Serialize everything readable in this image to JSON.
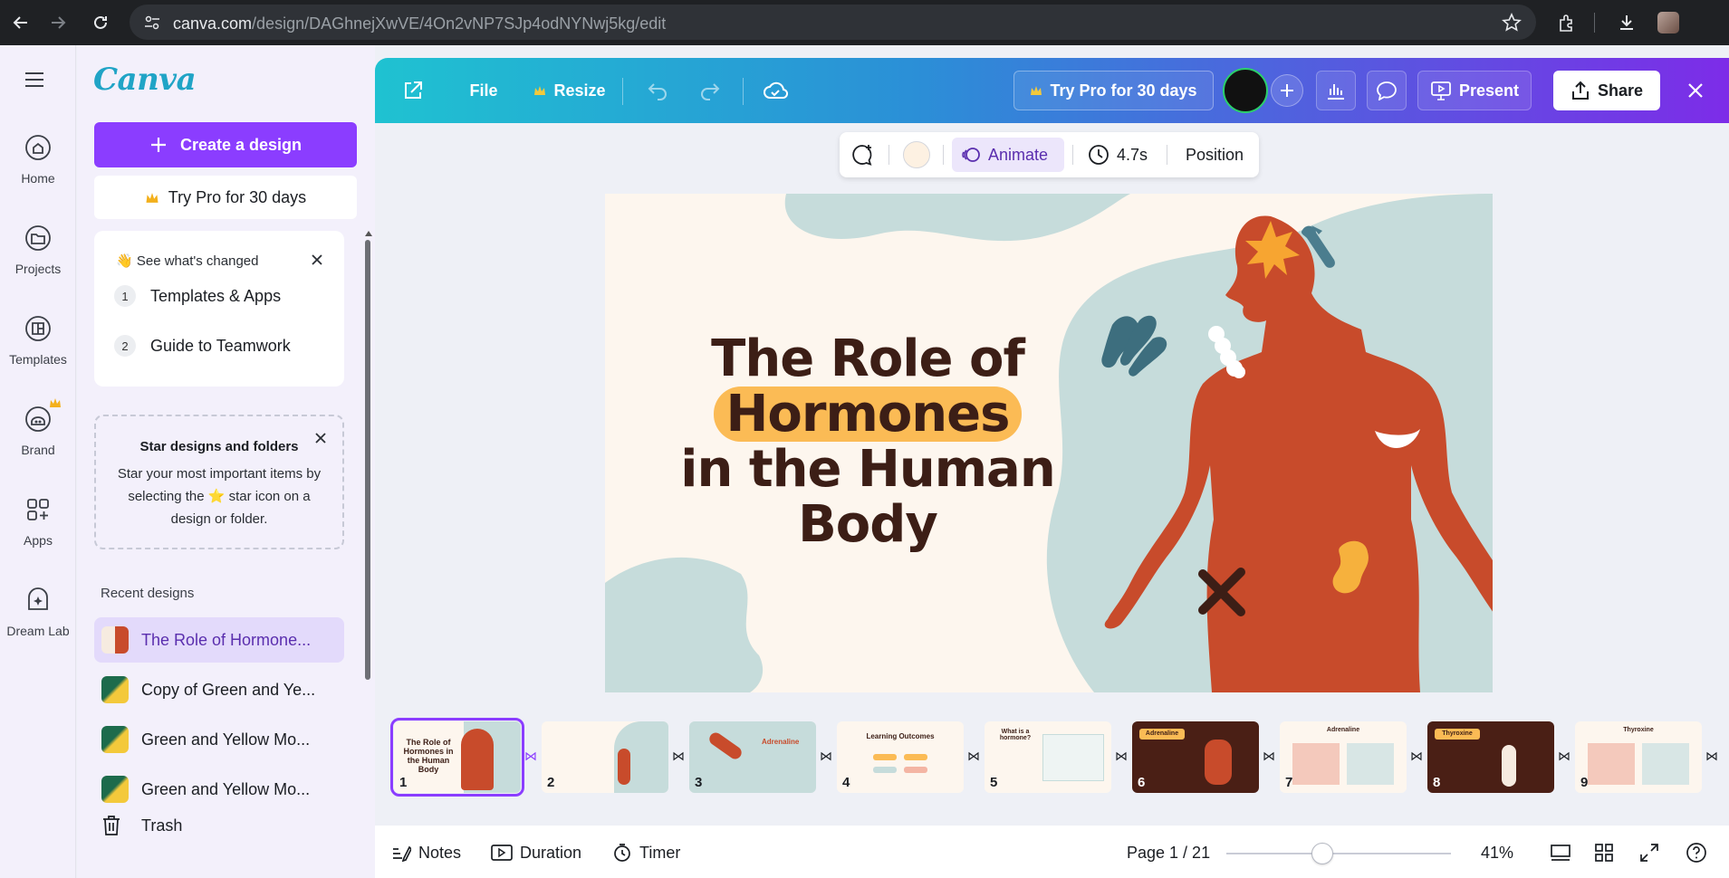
{
  "browser": {
    "url_host": "canva.com",
    "url_path": "/design/DAGhnejXwVE/4On2vNP7SJp4odNYNwj5kg/edit"
  },
  "rail": {
    "items": [
      {
        "label": "Home"
      },
      {
        "label": "Projects"
      },
      {
        "label": "Templates"
      },
      {
        "label": "Brand"
      },
      {
        "label": "Apps"
      },
      {
        "label": "Dream Lab"
      }
    ]
  },
  "panel": {
    "logo": "Canva",
    "create_label": "Create a design",
    "try_pro_label": "Try Pro for 30 days",
    "changes": {
      "title": "See what's changed",
      "items": [
        {
          "num": "1",
          "label": "Templates & Apps"
        },
        {
          "num": "2",
          "label": "Guide to Teamwork"
        }
      ]
    },
    "star_card": {
      "title": "Star designs and folders",
      "body": "Star your most important items by selecting the ⭐ star icon on a design or folder."
    },
    "recent_heading": "Recent designs",
    "recent": [
      {
        "label": "The Role of Hormone..."
      },
      {
        "label": "Copy of Green and Ye..."
      },
      {
        "label": "Green and Yellow Mo..."
      },
      {
        "label": "Green and Yellow Mo..."
      }
    ],
    "trash_label": "Trash"
  },
  "topbar": {
    "file_label": "File",
    "resize_label": "Resize",
    "try_pro_label": "Try Pro for 30 days",
    "present_label": "Present",
    "share_label": "Share"
  },
  "floatbar": {
    "animate_label": "Animate",
    "duration_value": "4.7s",
    "position_label": "Position"
  },
  "slide": {
    "title_line1": "The Role of",
    "title_highlight": "Hormones",
    "title_line3": "in the Human",
    "title_line4": "Body"
  },
  "filmstrip": {
    "slides": [
      {
        "num": "1",
        "title": "The Role of Hormones in the Human Body"
      },
      {
        "num": "2",
        "title": ""
      },
      {
        "num": "3",
        "title": "Adrenaline"
      },
      {
        "num": "4",
        "title": "Learning Outcomes"
      },
      {
        "num": "5",
        "title": "What is a hormone?"
      },
      {
        "num": "6",
        "title": "Adrenaline"
      },
      {
        "num": "7",
        "title": "Adrenaline"
      },
      {
        "num": "8",
        "title": "Thyroxine"
      },
      {
        "num": "9",
        "title": "Thyroxine"
      }
    ]
  },
  "bottombar": {
    "notes_label": "Notes",
    "duration_label": "Duration",
    "timer_label": "Timer",
    "page_indicator": "Page 1 / 21",
    "zoom_value": "41%"
  },
  "colors": {
    "accent": "#8b3dff",
    "slide_bg": "#fdf6ee",
    "figure": "#c84b2b",
    "highlight": "#fbbb55",
    "blob": "#c6dcdb"
  }
}
